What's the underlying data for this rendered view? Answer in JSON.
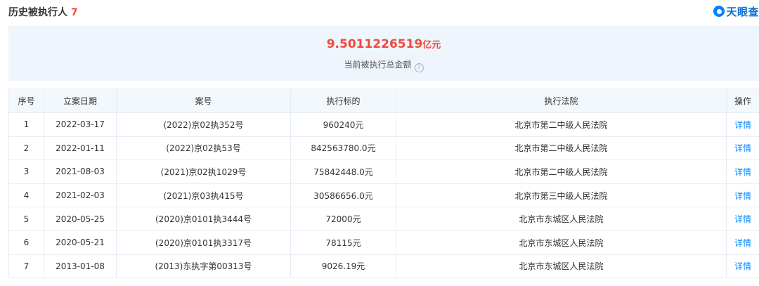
{
  "header": {
    "title": "历史被执行人",
    "count": "7",
    "logo_text": "天眼查"
  },
  "summary": {
    "amount": "9.5011226519",
    "unit": "亿元",
    "label": "当前被执行总金额",
    "help_glyph": "?"
  },
  "table": {
    "columns": [
      "序号",
      "立案日期",
      "案号",
      "执行标的",
      "执行法院",
      "操作"
    ],
    "rows": [
      {
        "index": "1",
        "date": "2022-03-17",
        "case_no": "(2022)京02执352号",
        "amount": "960240元",
        "court": "北京市第二中级人民法院",
        "action": "详情"
      },
      {
        "index": "2",
        "date": "2022-01-11",
        "case_no": "(2022)京02执53号",
        "amount": "842563780.0元",
        "court": "北京市第二中级人民法院",
        "action": "详情"
      },
      {
        "index": "3",
        "date": "2021-08-03",
        "case_no": "(2021)京02执1029号",
        "amount": "75842448.0元",
        "court": "北京市第二中级人民法院",
        "action": "详情"
      },
      {
        "index": "4",
        "date": "2021-02-03",
        "case_no": "(2021)京03执415号",
        "amount": "30586656.0元",
        "court": "北京市第三中级人民法院",
        "action": "详情"
      },
      {
        "index": "5",
        "date": "2020-05-25",
        "case_no": "(2020)京0101执3444号",
        "amount": "72000元",
        "court": "北京市东城区人民法院",
        "action": "详情"
      },
      {
        "index": "6",
        "date": "2020-05-21",
        "case_no": "(2020)京0101执3317号",
        "amount": "78115元",
        "court": "北京市东城区人民法院",
        "action": "详情"
      },
      {
        "index": "7",
        "date": "2013-01-08",
        "case_no": "(2013)东执字第00313号",
        "amount": "9026.19元",
        "court": "北京市东城区人民法院",
        "action": "详情"
      }
    ]
  },
  "colors": {
    "accent_red": "#f04a3a",
    "link_blue": "#0084ff",
    "summary_bg": "#eef5fc",
    "header_bg": "#f3f8fd"
  }
}
